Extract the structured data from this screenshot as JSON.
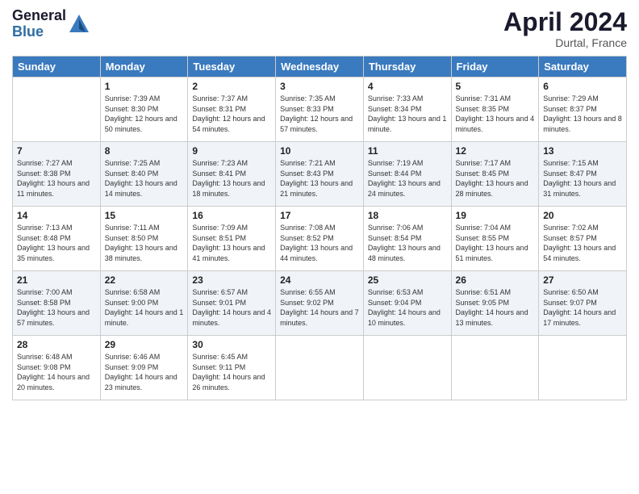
{
  "header": {
    "logo_general": "General",
    "logo_blue": "Blue",
    "title": "April 2024",
    "location": "Durtal, France"
  },
  "days_of_week": [
    "Sunday",
    "Monday",
    "Tuesday",
    "Wednesday",
    "Thursday",
    "Friday",
    "Saturday"
  ],
  "weeks": [
    [
      {
        "day": "",
        "sunrise": "",
        "sunset": "",
        "daylight": ""
      },
      {
        "day": "1",
        "sunrise": "Sunrise: 7:39 AM",
        "sunset": "Sunset: 8:30 PM",
        "daylight": "Daylight: 12 hours and 50 minutes."
      },
      {
        "day": "2",
        "sunrise": "Sunrise: 7:37 AM",
        "sunset": "Sunset: 8:31 PM",
        "daylight": "Daylight: 12 hours and 54 minutes."
      },
      {
        "day": "3",
        "sunrise": "Sunrise: 7:35 AM",
        "sunset": "Sunset: 8:33 PM",
        "daylight": "Daylight: 12 hours and 57 minutes."
      },
      {
        "day": "4",
        "sunrise": "Sunrise: 7:33 AM",
        "sunset": "Sunset: 8:34 PM",
        "daylight": "Daylight: 13 hours and 1 minute."
      },
      {
        "day": "5",
        "sunrise": "Sunrise: 7:31 AM",
        "sunset": "Sunset: 8:35 PM",
        "daylight": "Daylight: 13 hours and 4 minutes."
      },
      {
        "day": "6",
        "sunrise": "Sunrise: 7:29 AM",
        "sunset": "Sunset: 8:37 PM",
        "daylight": "Daylight: 13 hours and 8 minutes."
      }
    ],
    [
      {
        "day": "7",
        "sunrise": "Sunrise: 7:27 AM",
        "sunset": "Sunset: 8:38 PM",
        "daylight": "Daylight: 13 hours and 11 minutes."
      },
      {
        "day": "8",
        "sunrise": "Sunrise: 7:25 AM",
        "sunset": "Sunset: 8:40 PM",
        "daylight": "Daylight: 13 hours and 14 minutes."
      },
      {
        "day": "9",
        "sunrise": "Sunrise: 7:23 AM",
        "sunset": "Sunset: 8:41 PM",
        "daylight": "Daylight: 13 hours and 18 minutes."
      },
      {
        "day": "10",
        "sunrise": "Sunrise: 7:21 AM",
        "sunset": "Sunset: 8:43 PM",
        "daylight": "Daylight: 13 hours and 21 minutes."
      },
      {
        "day": "11",
        "sunrise": "Sunrise: 7:19 AM",
        "sunset": "Sunset: 8:44 PM",
        "daylight": "Daylight: 13 hours and 24 minutes."
      },
      {
        "day": "12",
        "sunrise": "Sunrise: 7:17 AM",
        "sunset": "Sunset: 8:45 PM",
        "daylight": "Daylight: 13 hours and 28 minutes."
      },
      {
        "day": "13",
        "sunrise": "Sunrise: 7:15 AM",
        "sunset": "Sunset: 8:47 PM",
        "daylight": "Daylight: 13 hours and 31 minutes."
      }
    ],
    [
      {
        "day": "14",
        "sunrise": "Sunrise: 7:13 AM",
        "sunset": "Sunset: 8:48 PM",
        "daylight": "Daylight: 13 hours and 35 minutes."
      },
      {
        "day": "15",
        "sunrise": "Sunrise: 7:11 AM",
        "sunset": "Sunset: 8:50 PM",
        "daylight": "Daylight: 13 hours and 38 minutes."
      },
      {
        "day": "16",
        "sunrise": "Sunrise: 7:09 AM",
        "sunset": "Sunset: 8:51 PM",
        "daylight": "Daylight: 13 hours and 41 minutes."
      },
      {
        "day": "17",
        "sunrise": "Sunrise: 7:08 AM",
        "sunset": "Sunset: 8:52 PM",
        "daylight": "Daylight: 13 hours and 44 minutes."
      },
      {
        "day": "18",
        "sunrise": "Sunrise: 7:06 AM",
        "sunset": "Sunset: 8:54 PM",
        "daylight": "Daylight: 13 hours and 48 minutes."
      },
      {
        "day": "19",
        "sunrise": "Sunrise: 7:04 AM",
        "sunset": "Sunset: 8:55 PM",
        "daylight": "Daylight: 13 hours and 51 minutes."
      },
      {
        "day": "20",
        "sunrise": "Sunrise: 7:02 AM",
        "sunset": "Sunset: 8:57 PM",
        "daylight": "Daylight: 13 hours and 54 minutes."
      }
    ],
    [
      {
        "day": "21",
        "sunrise": "Sunrise: 7:00 AM",
        "sunset": "Sunset: 8:58 PM",
        "daylight": "Daylight: 13 hours and 57 minutes."
      },
      {
        "day": "22",
        "sunrise": "Sunrise: 6:58 AM",
        "sunset": "Sunset: 9:00 PM",
        "daylight": "Daylight: 14 hours and 1 minute."
      },
      {
        "day": "23",
        "sunrise": "Sunrise: 6:57 AM",
        "sunset": "Sunset: 9:01 PM",
        "daylight": "Daylight: 14 hours and 4 minutes."
      },
      {
        "day": "24",
        "sunrise": "Sunrise: 6:55 AM",
        "sunset": "Sunset: 9:02 PM",
        "daylight": "Daylight: 14 hours and 7 minutes."
      },
      {
        "day": "25",
        "sunrise": "Sunrise: 6:53 AM",
        "sunset": "Sunset: 9:04 PM",
        "daylight": "Daylight: 14 hours and 10 minutes."
      },
      {
        "day": "26",
        "sunrise": "Sunrise: 6:51 AM",
        "sunset": "Sunset: 9:05 PM",
        "daylight": "Daylight: 14 hours and 13 minutes."
      },
      {
        "day": "27",
        "sunrise": "Sunrise: 6:50 AM",
        "sunset": "Sunset: 9:07 PM",
        "daylight": "Daylight: 14 hours and 17 minutes."
      }
    ],
    [
      {
        "day": "28",
        "sunrise": "Sunrise: 6:48 AM",
        "sunset": "Sunset: 9:08 PM",
        "daylight": "Daylight: 14 hours and 20 minutes."
      },
      {
        "day": "29",
        "sunrise": "Sunrise: 6:46 AM",
        "sunset": "Sunset: 9:09 PM",
        "daylight": "Daylight: 14 hours and 23 minutes."
      },
      {
        "day": "30",
        "sunrise": "Sunrise: 6:45 AM",
        "sunset": "Sunset: 9:11 PM",
        "daylight": "Daylight: 14 hours and 26 minutes."
      },
      {
        "day": "",
        "sunrise": "",
        "sunset": "",
        "daylight": ""
      },
      {
        "day": "",
        "sunrise": "",
        "sunset": "",
        "daylight": ""
      },
      {
        "day": "",
        "sunrise": "",
        "sunset": "",
        "daylight": ""
      },
      {
        "day": "",
        "sunrise": "",
        "sunset": "",
        "daylight": ""
      }
    ]
  ]
}
